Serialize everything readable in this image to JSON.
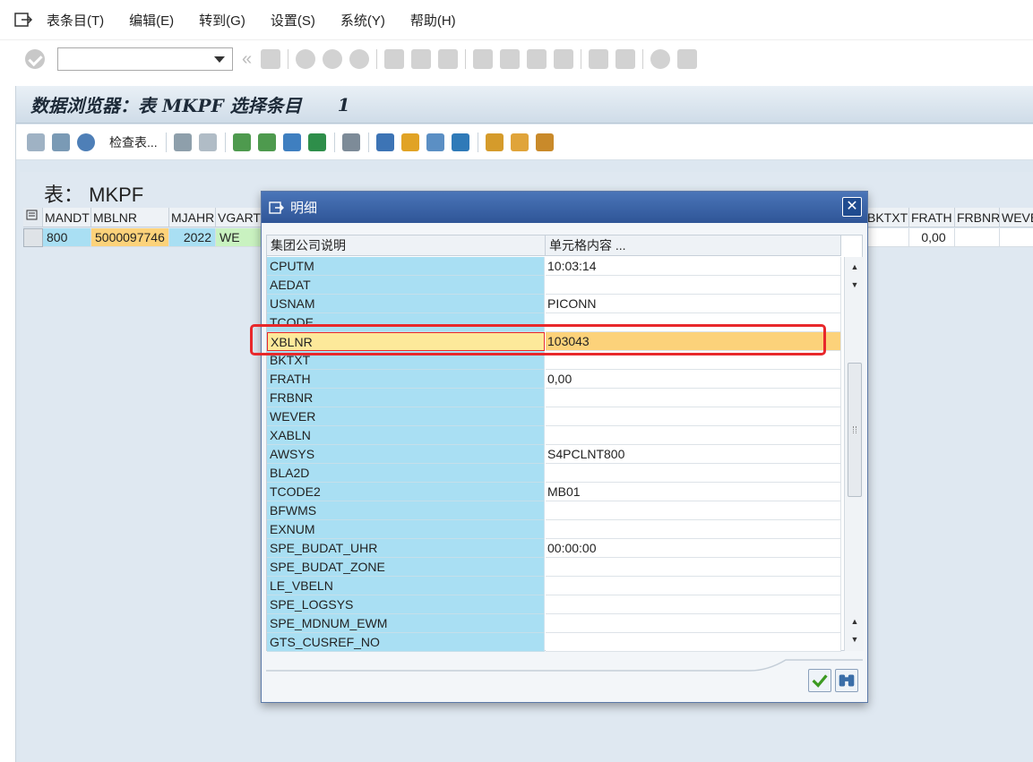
{
  "menubar": {
    "items": [
      "表条目(T)",
      "编辑(E)",
      "转到(G)",
      "设置(S)",
      "系统(Y)",
      "帮助(H)"
    ]
  },
  "systoolbar": {
    "command_value": ""
  },
  "title": {
    "text": "数据浏览器：表 MKPF 选择条目",
    "count": "1"
  },
  "app_toolbar": {
    "check_table_label": "检查表..."
  },
  "content": {
    "table_label": "表：  MKPF",
    "grid": {
      "left_headers": [
        "MANDT",
        "MBLNR",
        "MJAHR",
        "VGART"
      ],
      "right_headers": [
        "BKTXT",
        "FRATH",
        "FRBNR",
        "WEVE"
      ],
      "row_left": [
        "800",
        "5000097746",
        "2022",
        "WE"
      ],
      "row_right": [
        "",
        "0,00",
        "",
        ""
      ]
    }
  },
  "dialog": {
    "title": "明细",
    "col_desc": "集团公司说明",
    "col_value": "单元格内容 ...",
    "rows": [
      {
        "field": "CPUTM",
        "value": "10:03:14"
      },
      {
        "field": "AEDAT",
        "value": ""
      },
      {
        "field": "USNAM",
        "value": "PICONN"
      },
      {
        "field": "TCODE",
        "value": ""
      },
      {
        "field": "XBLNR",
        "value": "103043"
      },
      {
        "field": "BKTXT",
        "value": ""
      },
      {
        "field": "FRATH",
        "value": "0,00"
      },
      {
        "field": "FRBNR",
        "value": ""
      },
      {
        "field": "WEVER",
        "value": ""
      },
      {
        "field": "XABLN",
        "value": ""
      },
      {
        "field": "AWSYS",
        "value": "S4PCLNT800"
      },
      {
        "field": "BLA2D",
        "value": ""
      },
      {
        "field": "TCODE2",
        "value": "MB01"
      },
      {
        "field": "BFWMS",
        "value": ""
      },
      {
        "field": "EXNUM",
        "value": ""
      },
      {
        "field": "SPE_BUDAT_UHR",
        "value": "00:00:00"
      },
      {
        "field": "SPE_BUDAT_ZONE",
        "value": ""
      },
      {
        "field": "LE_VBELN",
        "value": ""
      },
      {
        "field": "SPE_LOGSYS",
        "value": ""
      },
      {
        "field": "SPE_MDNUM_EWM",
        "value": ""
      },
      {
        "field": "GTS_CUSREF_NO",
        "value": ""
      }
    ],
    "highlight_index": 4
  },
  "colors": {
    "field_cell": "#a9dff3",
    "highlight_field": "#fde99a",
    "highlight_value": "#fcd27a",
    "dialog_title": "#2f5597",
    "mblnr_cell": "#fcd27a",
    "mandt_cell": "#a9dff3",
    "vgart_cell": "#c9f2c0",
    "annotation_box": "#e8282b"
  }
}
